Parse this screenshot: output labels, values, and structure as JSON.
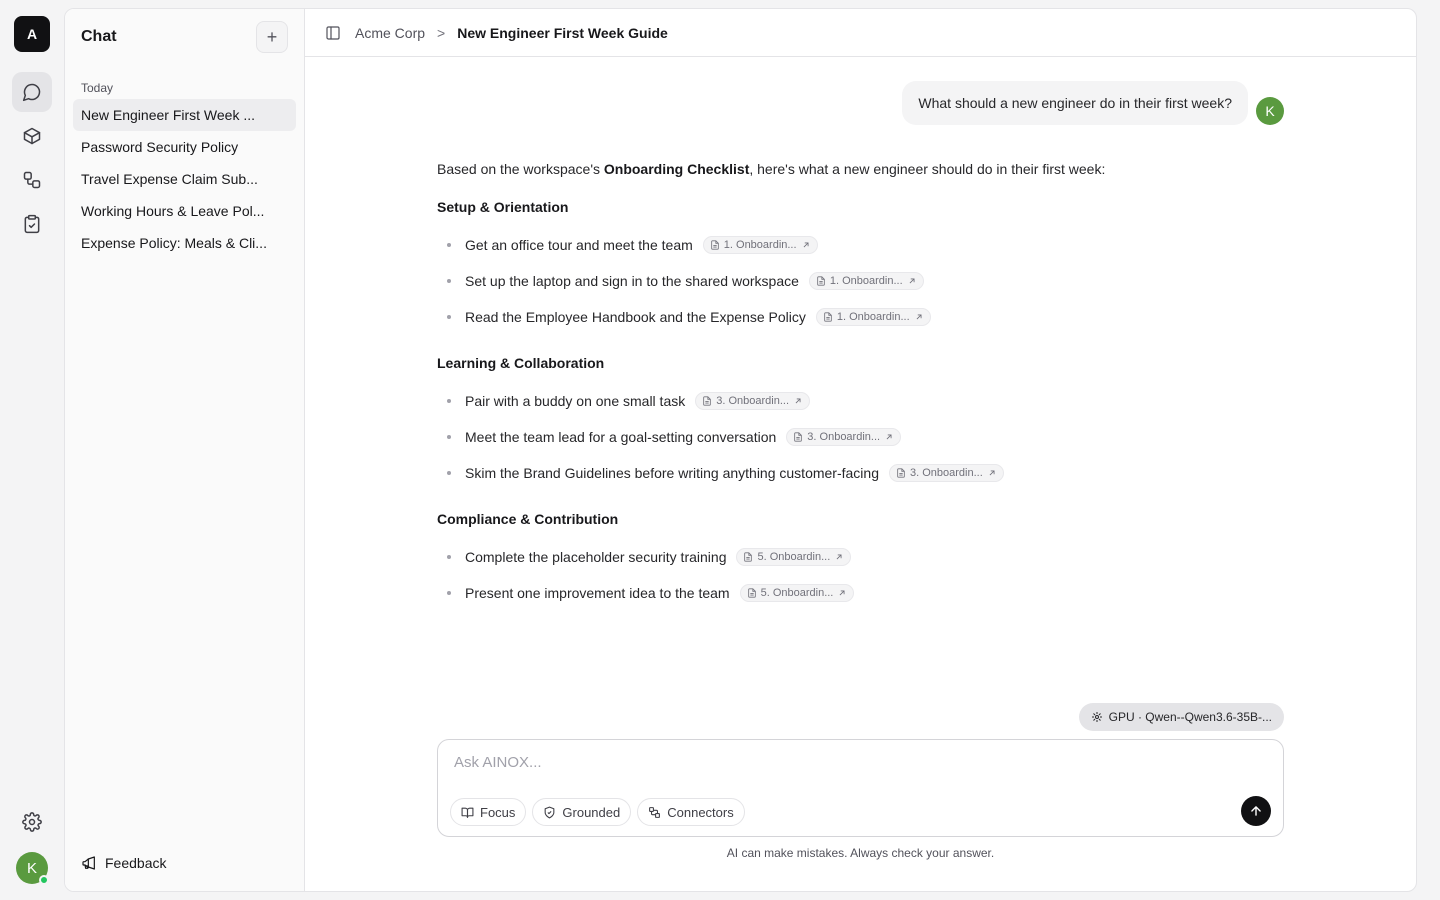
{
  "rail": {
    "org_initial": "A",
    "user_initial": "K",
    "nav": [
      {
        "icon": "chat-icon",
        "active": true
      },
      {
        "icon": "cube-icon",
        "active": false
      },
      {
        "icon": "workflow-icon",
        "active": false
      },
      {
        "icon": "clipboard-check-icon",
        "active": false
      }
    ]
  },
  "sidebar": {
    "title": "Chat",
    "new_chat_symbol": "+",
    "section_label": "Today",
    "items": [
      "New Engineer First Week ...",
      "Password Security Policy",
      "Travel Expense Claim Sub...",
      "Working Hours & Leave Pol...",
      "Expense Policy: Meals & Cli..."
    ],
    "feedback_label": "Feedback"
  },
  "breadcrumb": {
    "parent": "Acme Corp",
    "separator": ">",
    "current": "New Engineer First Week Guide"
  },
  "conversation": {
    "user_message": "What should a new engineer do in their first week?",
    "user_initial": "K",
    "answer": {
      "intro_before": "Based on the workspace's ",
      "intro_bold": "Onboarding Checklist",
      "intro_after": ", here's what a new engineer should do in their first week:",
      "sections": [
        {
          "heading": "Setup & Orientation",
          "items": [
            {
              "text": "Get an office tour and meet the team",
              "cite": "1. Onboardin..."
            },
            {
              "text": "Set up the laptop and sign in to the shared workspace",
              "cite": "1. Onboardin..."
            },
            {
              "text": "Read the Employee Handbook and the Expense Policy",
              "cite": "1. Onboardin..."
            }
          ]
        },
        {
          "heading": "Learning & Collaboration",
          "items": [
            {
              "text": "Pair with a buddy on one small task",
              "cite": "3. Onboardin..."
            },
            {
              "text": "Meet the team lead for a goal-setting conversation",
              "cite": "3. Onboardin..."
            },
            {
              "text": "Skim the Brand Guidelines before writing anything customer-facing",
              "cite": "3. Onboardin..."
            }
          ]
        },
        {
          "heading": "Compliance & Contribution",
          "items": [
            {
              "text": "Complete the placeholder security training",
              "cite": "5. Onboardin..."
            },
            {
              "text": "Present one improvement idea to the team",
              "cite": "5. Onboardin..."
            }
          ]
        }
      ]
    }
  },
  "model_chip": "GPU · Qwen--Qwen3.6-35B-...",
  "composer": {
    "placeholder": "Ask AINOX...",
    "value": "",
    "tools": [
      "Focus",
      "Grounded",
      "Connectors"
    ]
  },
  "disclaimer": "AI can make mistakes. Always check your answer."
}
